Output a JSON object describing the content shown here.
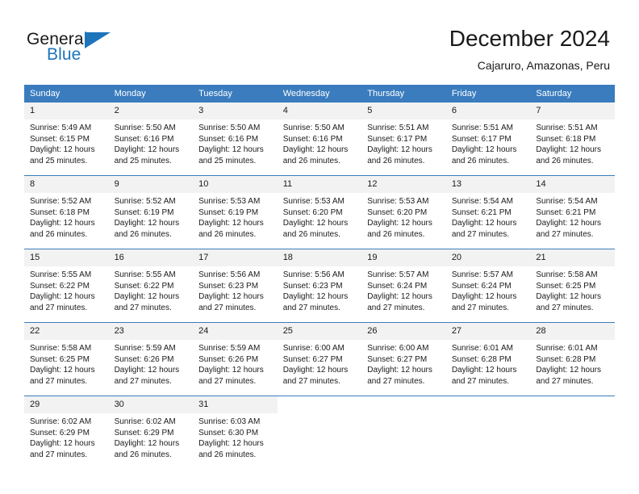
{
  "brand": {
    "name_part1": "General",
    "name_part2": "Blue",
    "triangle_color": "#1d74bb"
  },
  "header": {
    "title": "December 2024",
    "subtitle": "Cajaruro, Amazonas, Peru"
  },
  "theme": {
    "header_blue": "#3a7cbe",
    "daynum_band": "#f2f2f2",
    "text": "#1a1a1a"
  },
  "weekdays": [
    "Sunday",
    "Monday",
    "Tuesday",
    "Wednesday",
    "Thursday",
    "Friday",
    "Saturday"
  ],
  "labels": {
    "sunrise_prefix": "Sunrise:",
    "sunset_prefix": "Sunset:",
    "daylight_prefix": "Daylight:"
  },
  "weeks": [
    [
      {
        "day": "1",
        "sunrise": "Sunrise: 5:49 AM",
        "sunset": "Sunset: 6:15 PM",
        "daylight": "Daylight: 12 hours and 25 minutes."
      },
      {
        "day": "2",
        "sunrise": "Sunrise: 5:50 AM",
        "sunset": "Sunset: 6:16 PM",
        "daylight": "Daylight: 12 hours and 25 minutes."
      },
      {
        "day": "3",
        "sunrise": "Sunrise: 5:50 AM",
        "sunset": "Sunset: 6:16 PM",
        "daylight": "Daylight: 12 hours and 25 minutes."
      },
      {
        "day": "4",
        "sunrise": "Sunrise: 5:50 AM",
        "sunset": "Sunset: 6:16 PM",
        "daylight": "Daylight: 12 hours and 26 minutes."
      },
      {
        "day": "5",
        "sunrise": "Sunrise: 5:51 AM",
        "sunset": "Sunset: 6:17 PM",
        "daylight": "Daylight: 12 hours and 26 minutes."
      },
      {
        "day": "6",
        "sunrise": "Sunrise: 5:51 AM",
        "sunset": "Sunset: 6:17 PM",
        "daylight": "Daylight: 12 hours and 26 minutes."
      },
      {
        "day": "7",
        "sunrise": "Sunrise: 5:51 AM",
        "sunset": "Sunset: 6:18 PM",
        "daylight": "Daylight: 12 hours and 26 minutes."
      }
    ],
    [
      {
        "day": "8",
        "sunrise": "Sunrise: 5:52 AM",
        "sunset": "Sunset: 6:18 PM",
        "daylight": "Daylight: 12 hours and 26 minutes."
      },
      {
        "day": "9",
        "sunrise": "Sunrise: 5:52 AM",
        "sunset": "Sunset: 6:19 PM",
        "daylight": "Daylight: 12 hours and 26 minutes."
      },
      {
        "day": "10",
        "sunrise": "Sunrise: 5:53 AM",
        "sunset": "Sunset: 6:19 PM",
        "daylight": "Daylight: 12 hours and 26 minutes."
      },
      {
        "day": "11",
        "sunrise": "Sunrise: 5:53 AM",
        "sunset": "Sunset: 6:20 PM",
        "daylight": "Daylight: 12 hours and 26 minutes."
      },
      {
        "day": "12",
        "sunrise": "Sunrise: 5:53 AM",
        "sunset": "Sunset: 6:20 PM",
        "daylight": "Daylight: 12 hours and 26 minutes."
      },
      {
        "day": "13",
        "sunrise": "Sunrise: 5:54 AM",
        "sunset": "Sunset: 6:21 PM",
        "daylight": "Daylight: 12 hours and 27 minutes."
      },
      {
        "day": "14",
        "sunrise": "Sunrise: 5:54 AM",
        "sunset": "Sunset: 6:21 PM",
        "daylight": "Daylight: 12 hours and 27 minutes."
      }
    ],
    [
      {
        "day": "15",
        "sunrise": "Sunrise: 5:55 AM",
        "sunset": "Sunset: 6:22 PM",
        "daylight": "Daylight: 12 hours and 27 minutes."
      },
      {
        "day": "16",
        "sunrise": "Sunrise: 5:55 AM",
        "sunset": "Sunset: 6:22 PM",
        "daylight": "Daylight: 12 hours and 27 minutes."
      },
      {
        "day": "17",
        "sunrise": "Sunrise: 5:56 AM",
        "sunset": "Sunset: 6:23 PM",
        "daylight": "Daylight: 12 hours and 27 minutes."
      },
      {
        "day": "18",
        "sunrise": "Sunrise: 5:56 AM",
        "sunset": "Sunset: 6:23 PM",
        "daylight": "Daylight: 12 hours and 27 minutes."
      },
      {
        "day": "19",
        "sunrise": "Sunrise: 5:57 AM",
        "sunset": "Sunset: 6:24 PM",
        "daylight": "Daylight: 12 hours and 27 minutes."
      },
      {
        "day": "20",
        "sunrise": "Sunrise: 5:57 AM",
        "sunset": "Sunset: 6:24 PM",
        "daylight": "Daylight: 12 hours and 27 minutes."
      },
      {
        "day": "21",
        "sunrise": "Sunrise: 5:58 AM",
        "sunset": "Sunset: 6:25 PM",
        "daylight": "Daylight: 12 hours and 27 minutes."
      }
    ],
    [
      {
        "day": "22",
        "sunrise": "Sunrise: 5:58 AM",
        "sunset": "Sunset: 6:25 PM",
        "daylight": "Daylight: 12 hours and 27 minutes."
      },
      {
        "day": "23",
        "sunrise": "Sunrise: 5:59 AM",
        "sunset": "Sunset: 6:26 PM",
        "daylight": "Daylight: 12 hours and 27 minutes."
      },
      {
        "day": "24",
        "sunrise": "Sunrise: 5:59 AM",
        "sunset": "Sunset: 6:26 PM",
        "daylight": "Daylight: 12 hours and 27 minutes."
      },
      {
        "day": "25",
        "sunrise": "Sunrise: 6:00 AM",
        "sunset": "Sunset: 6:27 PM",
        "daylight": "Daylight: 12 hours and 27 minutes."
      },
      {
        "day": "26",
        "sunrise": "Sunrise: 6:00 AM",
        "sunset": "Sunset: 6:27 PM",
        "daylight": "Daylight: 12 hours and 27 minutes."
      },
      {
        "day": "27",
        "sunrise": "Sunrise: 6:01 AM",
        "sunset": "Sunset: 6:28 PM",
        "daylight": "Daylight: 12 hours and 27 minutes."
      },
      {
        "day": "28",
        "sunrise": "Sunrise: 6:01 AM",
        "sunset": "Sunset: 6:28 PM",
        "daylight": "Daylight: 12 hours and 27 minutes."
      }
    ],
    [
      {
        "day": "29",
        "sunrise": "Sunrise: 6:02 AM",
        "sunset": "Sunset: 6:29 PM",
        "daylight": "Daylight: 12 hours and 27 minutes."
      },
      {
        "day": "30",
        "sunrise": "Sunrise: 6:02 AM",
        "sunset": "Sunset: 6:29 PM",
        "daylight": "Daylight: 12 hours and 26 minutes."
      },
      {
        "day": "31",
        "sunrise": "Sunrise: 6:03 AM",
        "sunset": "Sunset: 6:30 PM",
        "daylight": "Daylight: 12 hours and 26 minutes."
      },
      {
        "day": "",
        "sunrise": "",
        "sunset": "",
        "daylight": ""
      },
      {
        "day": "",
        "sunrise": "",
        "sunset": "",
        "daylight": ""
      },
      {
        "day": "",
        "sunrise": "",
        "sunset": "",
        "daylight": ""
      },
      {
        "day": "",
        "sunrise": "",
        "sunset": "",
        "daylight": ""
      }
    ]
  ]
}
